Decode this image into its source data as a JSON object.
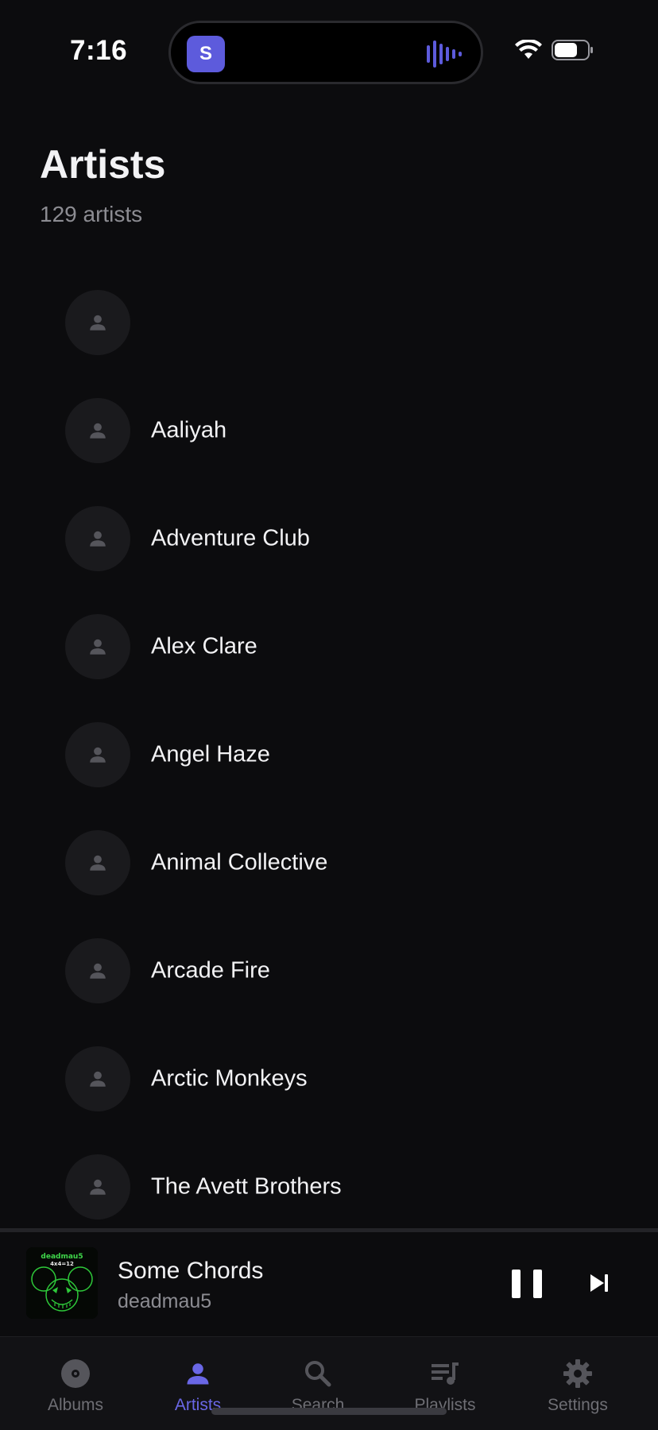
{
  "status_bar": {
    "time": "7:16",
    "island_app_letter": "S",
    "icons": [
      "wifi-icon",
      "battery-icon"
    ]
  },
  "header": {
    "title": "Artists",
    "subtitle": "129 artists"
  },
  "artists": [
    {
      "name": ""
    },
    {
      "name": "Aaliyah"
    },
    {
      "name": "Adventure Club"
    },
    {
      "name": "Alex Clare"
    },
    {
      "name": "Angel Haze"
    },
    {
      "name": "Animal Collective"
    },
    {
      "name": "Arcade Fire"
    },
    {
      "name": "Arctic Monkeys"
    },
    {
      "name": "The Avett Brothers"
    }
  ],
  "now_playing": {
    "title": "Some Chords",
    "artist": "deadmau5",
    "art_text_line1": "deadmau5",
    "art_text_line2": "4x4=12"
  },
  "tabs": [
    {
      "label": "Albums",
      "icon": "disc-icon",
      "active": false
    },
    {
      "label": "Artists",
      "icon": "person-icon",
      "active": true
    },
    {
      "label": "Search",
      "icon": "search-icon",
      "active": false
    },
    {
      "label": "Playlists",
      "icon": "playlist-icon",
      "active": false
    },
    {
      "label": "Settings",
      "icon": "gear-icon",
      "active": false
    }
  ],
  "colors": {
    "background": "#0c0c0e",
    "accent": "#6a67e6",
    "text_secondary": "#8c8c92"
  }
}
